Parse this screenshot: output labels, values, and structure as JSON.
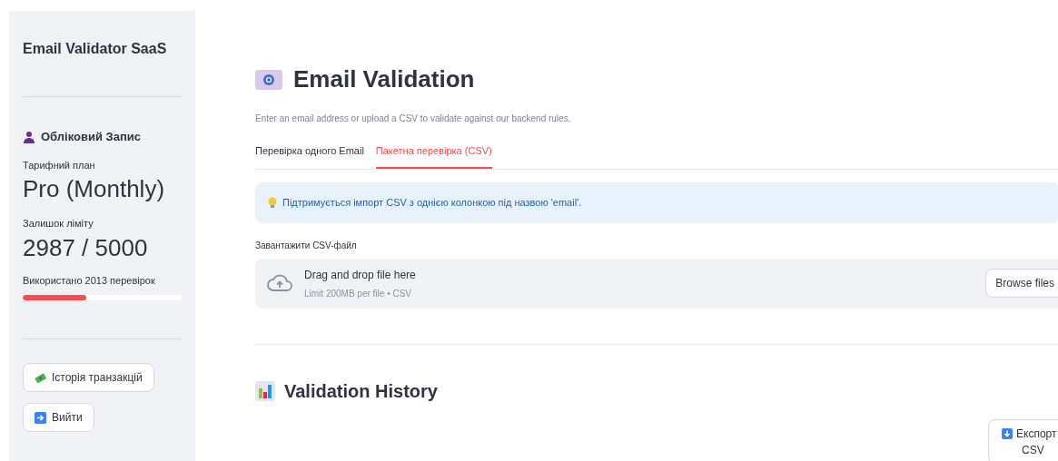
{
  "sidebar": {
    "title": "Email Validator SaaS",
    "account_heading": "Обліковий Запис",
    "plan_label": "Тарифний план",
    "plan_value": "Pro (Monthly)",
    "limit_label": "Залишок ліміту",
    "limit_value": "2987 / 5000",
    "usage_label": "Використано 2013 перевірок",
    "usage": {
      "level": 0.4
    },
    "buttons": [
      {
        "kind": "money",
        "label": "Історія транзакцій"
      },
      {
        "kind": "logout",
        "label": "Вийти"
      }
    ]
  },
  "main": {
    "title": "Email Validation",
    "subtitle": "Enter an email address or upload a CSV to validate against our backend rules.",
    "tabs": [
      {
        "label": "Перевірка одного Email",
        "selected": false
      },
      {
        "label": "Пакетна перевірка (CSV)",
        "selected": true
      }
    ],
    "info": "Підтримується імпорт CSV з однією колонкою під назвою 'email'.",
    "upload": {
      "label": "Завантажити CSV-файл",
      "title": "Drag and drop file here",
      "hint": "Limit 200MB per file • CSV",
      "button": "Browse files"
    },
    "history_title": "Validation History",
    "export_button": [
      "Експорт",
      "CSV"
    ]
  }
}
